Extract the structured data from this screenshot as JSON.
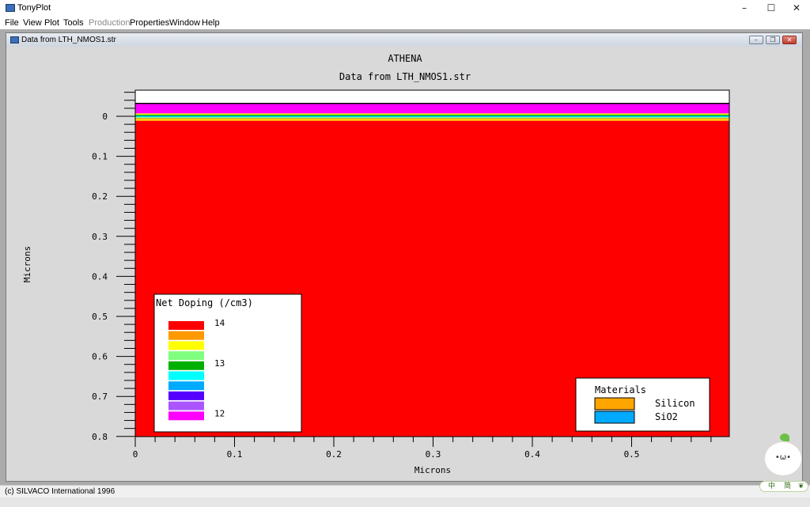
{
  "window": {
    "title": "TonyPlot",
    "minimize_glyph": "–",
    "maximize_glyph": "☐",
    "close_glyph": "✕"
  },
  "menu": [
    {
      "label": "File",
      "enabled": true
    },
    {
      "label": "View",
      "enabled": true
    },
    {
      "label": "Plot",
      "enabled": true
    },
    {
      "label": "Tools",
      "enabled": true
    },
    {
      "label": "Production",
      "enabled": false
    },
    {
      "label": "Properties",
      "enabled": true
    },
    {
      "label": "Window",
      "enabled": true
    },
    {
      "label": "Help",
      "enabled": true
    }
  ],
  "child_window": {
    "title": "Data from LTH_NMOS1.str",
    "minimize_glyph": "–",
    "restore_glyph": "❐",
    "close_glyph": "✕"
  },
  "status": {
    "text": "(c) SILVACO International 1996"
  },
  "ime": {
    "face": "•ω•",
    "label_1": "中",
    "label_2": "简",
    "label_3": "❦"
  },
  "colors": {
    "plot_bg": "#ff0000",
    "top_white": "#ffffff",
    "magenta": "#ff00ff",
    "border": "#000000"
  },
  "chart_data": {
    "type": "heatmap",
    "title": "ATHENA",
    "subtitle": "Data from LTH_NMOS1.str",
    "xlabel": "Microns",
    "ylabel": "Microns",
    "xlim": [
      0,
      0.6
    ],
    "ylim": [
      -0.035,
      0.8
    ],
    "y_inverted": true,
    "x_ticks": [
      0,
      0.1,
      0.2,
      0.3,
      0.4,
      0.5
    ],
    "x_tick_labels": [
      "0",
      "0.1",
      "0.2",
      "0.3",
      "0.4",
      "0.5"
    ],
    "y_ticks": [
      0,
      0.1,
      0.2,
      0.3,
      0.4,
      0.5,
      0.6,
      0.7,
      0.8
    ],
    "y_tick_labels": [
      "0",
      "0.1",
      "0.2",
      "0.3",
      "0.4",
      "0.5",
      "0.6",
      "0.7",
      "0.8"
    ],
    "layers": [
      {
        "y0": -0.035,
        "y1": -0.035,
        "color": "#ffffff"
      },
      {
        "y0": -0.032,
        "y1": -0.007,
        "color": "#ff00ff"
      },
      {
        "y0": -0.007,
        "y1": -0.004,
        "color": "#ffff00"
      },
      {
        "y0": -0.004,
        "y1": -0.001,
        "color": "#00b000"
      },
      {
        "y0": -0.001,
        "y1": 0.002,
        "color": "#00ccff"
      },
      {
        "y0": 0.002,
        "y1": 0.005,
        "color": "#7fff7f"
      },
      {
        "y0": 0.005,
        "y1": 0.008,
        "color": "#ff9900"
      },
      {
        "y0": 0.008,
        "y1": 0.011,
        "color": "#ffff00"
      },
      {
        "y0": 0.011,
        "y1": 0.8,
        "color": "#ff0000"
      }
    ],
    "doping_legend": {
      "title": "Net Doping (/cm3)",
      "entries": [
        {
          "color": "#ff0000",
          "label": "14"
        },
        {
          "color": "#ff9900",
          "label": ""
        },
        {
          "color": "#ffff00",
          "label": ""
        },
        {
          "color": "#7fff7f",
          "label": ""
        },
        {
          "color": "#00b000",
          "label": "13"
        },
        {
          "color": "#00ffff",
          "label": ""
        },
        {
          "color": "#00aaff",
          "label": ""
        },
        {
          "color": "#5500ff",
          "label": ""
        },
        {
          "color": "#aa55ff",
          "label": ""
        },
        {
          "color": "#ff00ff",
          "label": "12"
        }
      ]
    },
    "materials_legend": {
      "title": "Materials",
      "entries": [
        {
          "color": "#ffa500",
          "label": "Silicon"
        },
        {
          "color": "#00aaff",
          "label": "SiO2"
        }
      ]
    }
  }
}
